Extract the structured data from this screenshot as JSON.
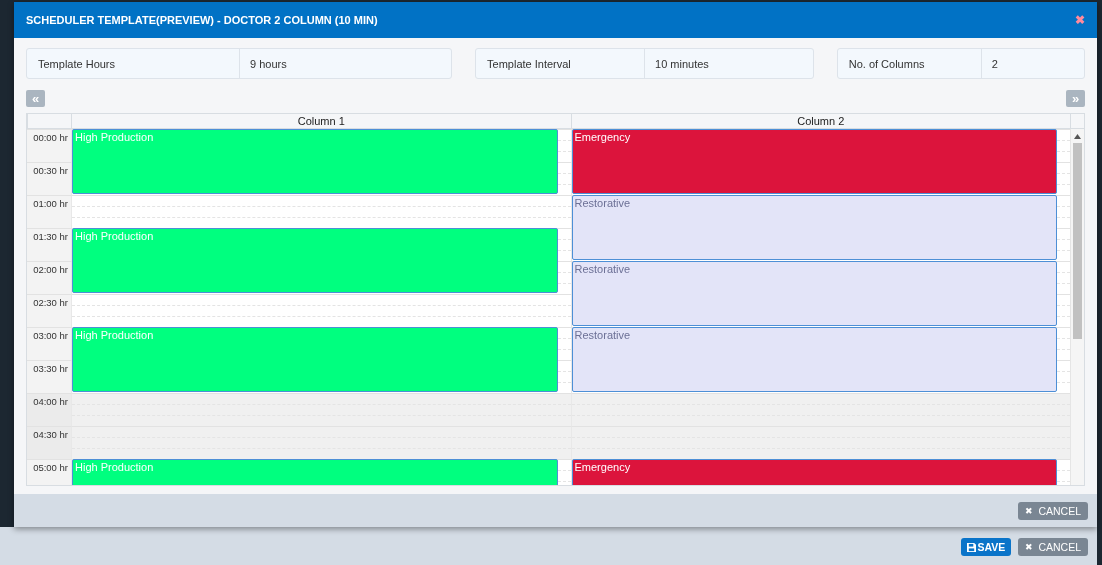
{
  "dialog": {
    "title": "SCHEDULER TEMPLATE(PREVIEW) - DOCTOR 2 COLUMN (10 MIN)",
    "close": "✖"
  },
  "info": [
    {
      "label": "Template Hours",
      "value": "9 hours"
    },
    {
      "label": "Template Interval",
      "value": "10 minutes"
    },
    {
      "label": "No. of Columns",
      "value": "2"
    }
  ],
  "nav": {
    "prev": "«",
    "next": "»"
  },
  "schedule": {
    "times": [
      {
        "label": "00:00 hr",
        "shaded": false
      },
      {
        "label": "00:30 hr",
        "shaded": false
      },
      {
        "label": "01:00 hr",
        "shaded": false
      },
      {
        "label": "01:30 hr",
        "shaded": false
      },
      {
        "label": "02:00 hr",
        "shaded": false
      },
      {
        "label": "02:30 hr",
        "shaded": false
      },
      {
        "label": "03:00 hr",
        "shaded": false
      },
      {
        "label": "03:30 hr",
        "shaded": false
      },
      {
        "label": "04:00 hr",
        "shaded": true
      },
      {
        "label": "04:30 hr",
        "shaded": true
      },
      {
        "label": "05:00 hr",
        "shaded": false
      }
    ],
    "columns": [
      {
        "title": "Column 1",
        "items": [
          {
            "kind": "event",
            "label": "High Production",
            "color": "#00ff7f"
          },
          {
            "kind": "empty"
          },
          {
            "kind": "event",
            "label": "High Production",
            "color": "#00ff7f"
          },
          {
            "kind": "empty"
          },
          {
            "kind": "event",
            "label": "High Production",
            "color": "#00ff7f"
          },
          {
            "kind": "empty"
          },
          {
            "kind": "empty"
          },
          {
            "kind": "event",
            "label": "High Production",
            "color": "#00ff7f"
          }
        ]
      },
      {
        "title": "Column 2",
        "items": [
          {
            "kind": "event",
            "label": "Emergency",
            "color": "#dc143c"
          },
          {
            "kind": "event",
            "label": "Restorative",
            "color": "#e3e4f8"
          },
          {
            "kind": "event",
            "label": "Restorative",
            "color": "#e3e4f8"
          },
          {
            "kind": "event",
            "label": "Restorative",
            "color": "#e3e4f8"
          },
          {
            "kind": "empty"
          },
          {
            "kind": "empty"
          },
          {
            "kind": "event",
            "label": "Emergency",
            "color": "#dc143c"
          }
        ]
      }
    ]
  },
  "dialog_footer": {
    "cancel": {
      "icon": "✖",
      "label": "CANCEL"
    }
  },
  "page_footer": {
    "save": {
      "label": "SAVE"
    },
    "cancel": {
      "icon": "✖",
      "label": "CANCEL"
    }
  }
}
